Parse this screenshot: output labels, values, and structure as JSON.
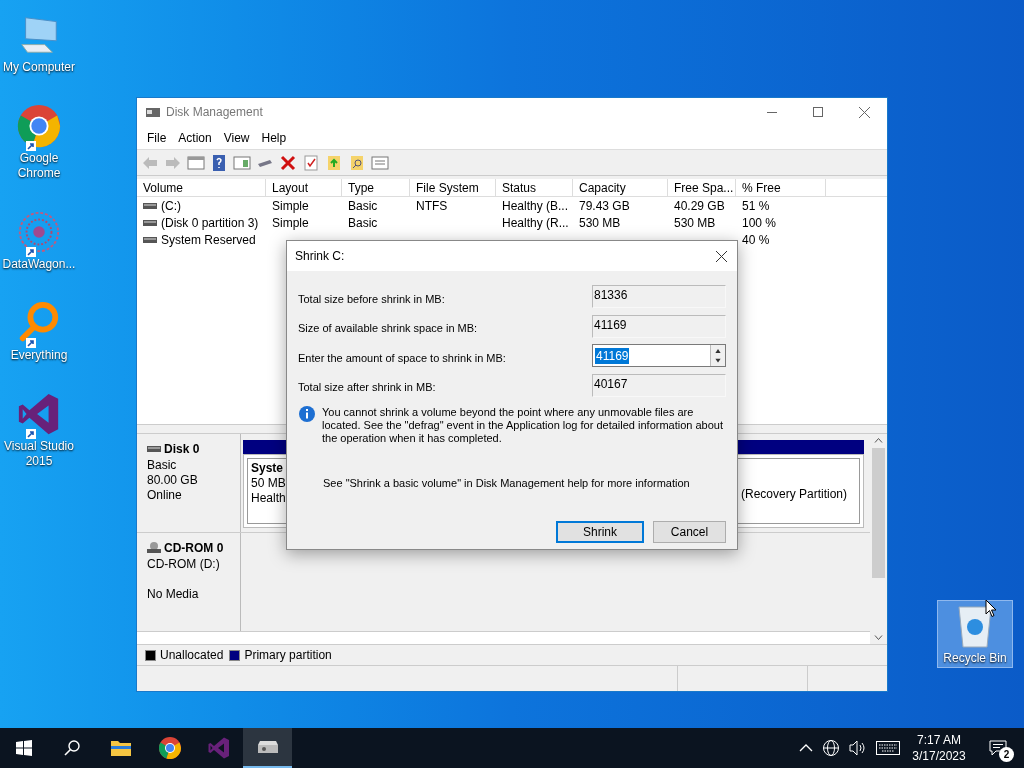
{
  "desktop_icons": [
    {
      "label": "My Computer",
      "kind": "computer",
      "shortcut": false,
      "selected": false
    },
    {
      "label": "Google Chrome",
      "kind": "chrome",
      "shortcut": true,
      "selected": false
    },
    {
      "label": "DataWagon...",
      "kind": "datawagon",
      "shortcut": true,
      "selected": false
    },
    {
      "label": "Everything",
      "kind": "everything",
      "shortcut": true,
      "selected": false
    },
    {
      "label": "Visual Studio 2015",
      "kind": "visualstudio",
      "shortcut": true,
      "selected": false
    }
  ],
  "recycle_bin": {
    "label": "Recycle Bin",
    "selected": true
  },
  "window": {
    "title": "Disk Management",
    "menu": [
      "File",
      "Action",
      "View",
      "Help"
    ],
    "columns": [
      "Volume",
      "Layout",
      "Type",
      "File System",
      "Status",
      "Capacity",
      "Free Spa...",
      "% Free"
    ],
    "rows": [
      {
        "cells": [
          "(C:)",
          "Simple",
          "Basic",
          "NTFS",
          "Healthy (B...",
          "79.43 GB",
          "40.29 GB",
          "51 %"
        ]
      },
      {
        "cells": [
          "(Disk 0 partition 3)",
          "Simple",
          "Basic",
          null,
          "Healthy (R...",
          "530 MB",
          "530 MB",
          "100 %"
        ]
      },
      {
        "cells": [
          "System Reserved",
          null,
          null,
          null,
          null,
          null,
          null,
          "40 %"
        ]
      }
    ],
    "disks": [
      {
        "kind": "disk",
        "name": "Disk 0",
        "lines": [
          "Basic",
          "80.00 GB",
          "Online"
        ],
        "partitions": [
          {
            "lines": [
              "Syste",
              "50 MB",
              "Health"
            ]
          },
          {
            "lines": [
              "(Recovery Partition)"
            ]
          }
        ]
      },
      {
        "kind": "cdrom",
        "name": "CD-ROM 0",
        "lines": [
          "CD-ROM (D:)",
          "No Media"
        ]
      }
    ],
    "legend": [
      {
        "label": "Unallocated",
        "color": "#000000"
      },
      {
        "label": "Primary partition",
        "color": "#000080"
      }
    ]
  },
  "dialog": {
    "title": "Shrink C:",
    "rows": [
      {
        "label": "Total size before shrink in MB:",
        "value": "81336",
        "editable": false
      },
      {
        "label": "Size of available shrink space in MB:",
        "value": "41169",
        "editable": false
      },
      {
        "label": "Enter the amount of space to shrink in MB:",
        "value": "41169",
        "editable": true
      },
      {
        "label": "Total size after shrink in MB:",
        "value": "40167",
        "editable": false
      }
    ],
    "info": "You cannot shrink a volume beyond the point where any unmovable files are located. See the \"defrag\" event in the Application log for detailed information about the operation when it has completed.",
    "help": "See \"Shrink a basic volume\" in Disk Management help for more information",
    "buttons": [
      {
        "label": "Shrink",
        "default": true
      },
      {
        "label": "Cancel",
        "default": false
      }
    ]
  },
  "taskbar": {
    "apps": [
      {
        "kind": "explorer",
        "selected": false
      },
      {
        "kind": "chrome",
        "selected": false
      },
      {
        "kind": "visualstudio",
        "selected": false
      },
      {
        "kind": "diskmgmt",
        "selected": true
      }
    ],
    "time": "7:17 AM",
    "date": "3/17/2023",
    "notifications": "2"
  }
}
